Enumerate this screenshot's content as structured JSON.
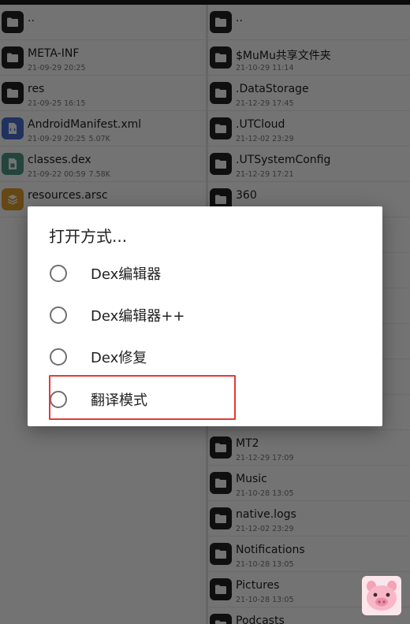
{
  "left_pane": {
    "items": [
      {
        "name": "..",
        "meta": "",
        "size": "",
        "icon": "folder-icon"
      },
      {
        "name": "META-INF",
        "meta": "21-09-29 20:25",
        "size": "",
        "icon": "folder-icon"
      },
      {
        "name": "res",
        "meta": "21-09-25 16:15",
        "size": "",
        "icon": "folder-icon"
      },
      {
        "name": "AndroidManifest.xml",
        "meta": "21-09-29 20:25",
        "size": "5.07K",
        "icon": "xml-file-icon"
      },
      {
        "name": "classes.dex",
        "meta": "21-09-22 00:59",
        "size": "7.58K",
        "icon": "dex-file-icon"
      },
      {
        "name": "resources.arsc",
        "meta": "",
        "size": "",
        "icon": "arsc-file-icon"
      }
    ]
  },
  "right_pane": {
    "items": [
      {
        "name": "..",
        "meta": "",
        "icon": "folder-icon"
      },
      {
        "name": "$MuMu共享文件夹",
        "meta": "21-10-29 11:14",
        "icon": "folder-icon"
      },
      {
        "name": ".DataStorage",
        "meta": "21-12-29 17:45",
        "icon": "folder-icon"
      },
      {
        "name": ".UTCloud",
        "meta": "21-12-02 23:29",
        "icon": "folder-icon"
      },
      {
        "name": ".UTSystemConfig",
        "meta": "21-12-29 17:21",
        "icon": "folder-icon"
      },
      {
        "name": "360",
        "meta": "",
        "icon": "folder-icon"
      },
      {
        "name": "",
        "meta": "",
        "icon": "folder-icon"
      },
      {
        "name": "",
        "meta": "",
        "icon": "folder-icon"
      },
      {
        "name": "",
        "meta": "",
        "icon": "folder-icon"
      },
      {
        "name": "",
        "meta": "",
        "icon": "folder-icon"
      },
      {
        "name": "",
        "meta": "",
        "icon": "folder-icon"
      },
      {
        "name": "",
        "meta": "",
        "icon": "folder-icon"
      },
      {
        "name": "MT2",
        "meta": "21-12-29 17:09",
        "icon": "folder-icon"
      },
      {
        "name": "Music",
        "meta": "21-10-28 13:05",
        "icon": "folder-icon"
      },
      {
        "name": "native.logs",
        "meta": "21-12-02 23:29",
        "icon": "folder-icon"
      },
      {
        "name": "Notifications",
        "meta": "21-10-28 13:05",
        "icon": "folder-icon"
      },
      {
        "name": "Pictures",
        "meta": "21-10-28 13:05",
        "icon": "folder-icon"
      },
      {
        "name": "Podcasts",
        "meta": "",
        "icon": "folder-icon"
      }
    ]
  },
  "dialog": {
    "title": "打开方式...",
    "options": [
      {
        "label": "Dex编辑器",
        "selected": false
      },
      {
        "label": "Dex编辑器++",
        "selected": false
      },
      {
        "label": "Dex修复",
        "selected": false
      },
      {
        "label": "翻译模式",
        "selected": false
      }
    ],
    "highlight_color": "#e53935"
  },
  "corner_widget": {
    "icon": "pig-mascot-icon"
  }
}
